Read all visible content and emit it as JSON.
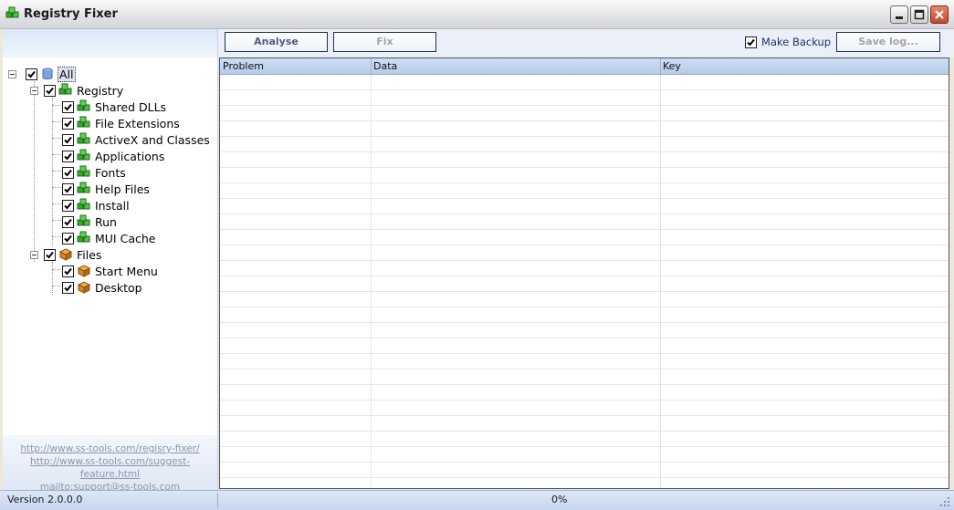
{
  "window": {
    "title": "Registry Fixer"
  },
  "toolbar": {
    "analyse_label": "Analyse",
    "fix_label": "Fix",
    "make_backup_label": "Make Backup",
    "make_backup_checked": true,
    "save_log_label": "Save log..."
  },
  "tree": {
    "root": {
      "label": "All",
      "checked": true,
      "icon": "database-icon"
    },
    "groups": [
      {
        "label": "Registry",
        "checked": true,
        "icon": "registry-cubes-icon",
        "items": [
          {
            "label": "Shared DLLs",
            "checked": true,
            "icon": "registry-cubes-icon"
          },
          {
            "label": "File Extensions",
            "checked": true,
            "icon": "registry-cubes-icon"
          },
          {
            "label": "ActiveX and Classes",
            "checked": true,
            "icon": "registry-cubes-icon"
          },
          {
            "label": "Applications",
            "checked": true,
            "icon": "registry-cubes-icon"
          },
          {
            "label": "Fonts",
            "checked": true,
            "icon": "registry-cubes-icon"
          },
          {
            "label": "Help Files",
            "checked": true,
            "icon": "registry-cubes-icon"
          },
          {
            "label": "Install",
            "checked": true,
            "icon": "registry-cubes-icon"
          },
          {
            "label": "Run",
            "checked": true,
            "icon": "registry-cubes-icon"
          },
          {
            "label": "MUI Cache",
            "checked": true,
            "icon": "registry-cubes-icon"
          }
        ]
      },
      {
        "label": "Files",
        "checked": true,
        "icon": "box-icon",
        "items": [
          {
            "label": "Start Menu",
            "checked": true,
            "icon": "box-icon"
          },
          {
            "label": "Desktop",
            "checked": true,
            "icon": "box-icon"
          }
        ]
      }
    ]
  },
  "links": {
    "homepage": "http://www.ss-tools.com/regisry-fixer/",
    "suggest": "http://www.ss-tools.com/suggest-feature.html",
    "mail": "mailto:support@ss-tools.com"
  },
  "grid": {
    "columns": [
      "Problem",
      "Data",
      "Key"
    ],
    "rows": []
  },
  "status": {
    "version": "Version 2.0.0.0",
    "progress": "0%"
  }
}
